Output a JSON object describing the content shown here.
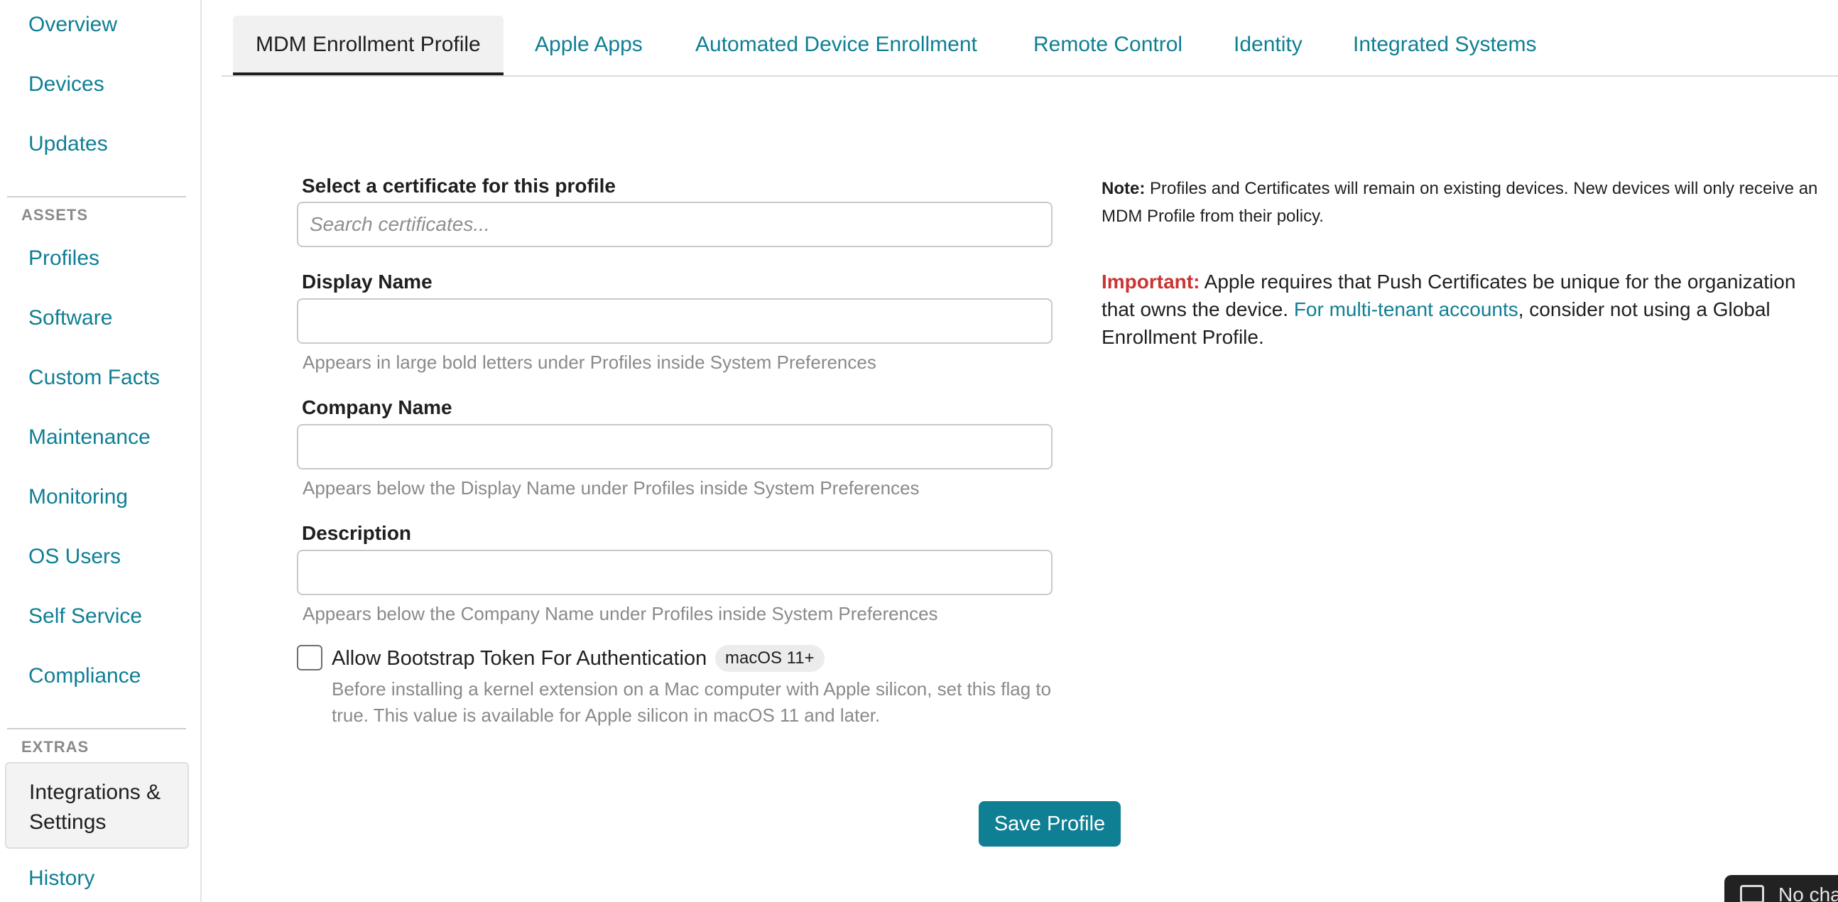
{
  "sidebar": {
    "items": [
      {
        "label": "Overview"
      },
      {
        "label": "Devices"
      },
      {
        "label": "Updates"
      }
    ],
    "assets_section": "ASSETS",
    "assets_items": [
      {
        "label": "Profiles"
      },
      {
        "label": "Software"
      },
      {
        "label": "Custom Facts"
      },
      {
        "label": "Maintenance"
      },
      {
        "label": "Monitoring"
      },
      {
        "label": "OS Users"
      },
      {
        "label": "Self Service"
      },
      {
        "label": "Compliance"
      }
    ],
    "extras_section": "EXTRAS",
    "active_item": "Integrations & Settings",
    "history": "History"
  },
  "tabs": [
    {
      "label": "MDM Enrollment Profile"
    },
    {
      "label": "Apple Apps"
    },
    {
      "label": "Automated Device Enrollment"
    },
    {
      "label": "Remote Control"
    },
    {
      "label": "Identity"
    },
    {
      "label": "Integrated Systems"
    }
  ],
  "form": {
    "certificate_label": "Select a certificate for this profile",
    "certificate_placeholder": "Search certificates...",
    "display_name_label": "Display Name",
    "display_name_value": "",
    "display_name_help": "Appears in large bold letters under Profiles inside System Preferences",
    "company_name_label": "Company Name",
    "company_name_value": "",
    "company_name_help": "Appears below the Display Name under Profiles inside System Preferences",
    "description_label": "Description",
    "description_value": "",
    "description_help": "Appears below the Company Name under Profiles inside System Preferences",
    "bootstrap_label": "Allow Bootstrap Token For Authentication",
    "bootstrap_badge": "macOS 11+",
    "bootstrap_help": "Before installing a kernel extension on a Mac computer with Apple silicon, set this flag to true. This value is available for Apple silicon in macOS 11 and later.",
    "save_label": "Save Profile"
  },
  "notes": {
    "note_strong": "Note:",
    "note_text": " Profiles and Certificates will remain on existing devices. New devices will only receive an MDM Profile from their policy.",
    "important_strong": "Important:",
    "important_text_1": " Apple requires that Push Certificates be unique for the organization that owns the device. ",
    "important_link": "For multi-tenant accounts",
    "important_text_2": ", consider not using a Global Enrollment Profile."
  },
  "widget": {
    "text": "No cha"
  },
  "colors": {
    "accent": "#0f7f94",
    "important": "#cc3333"
  }
}
